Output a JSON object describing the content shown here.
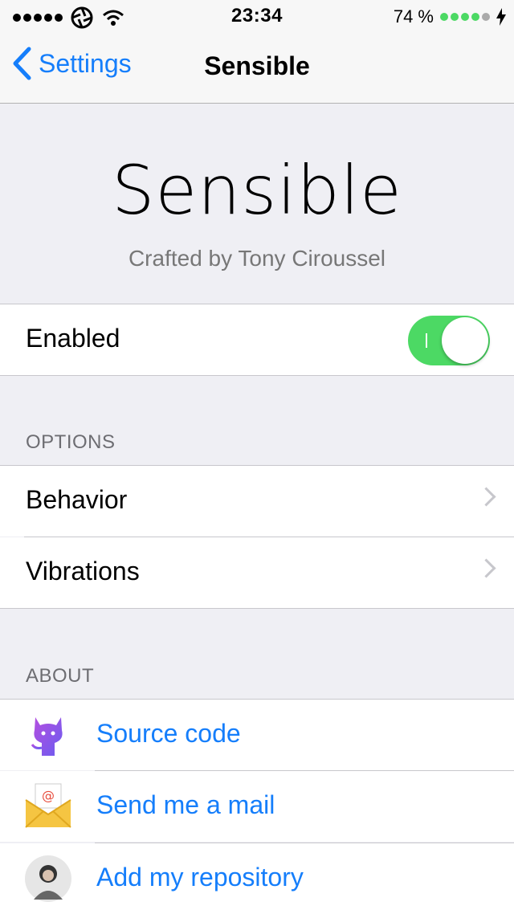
{
  "status_bar": {
    "time": "23:34",
    "battery_percent": "74 %",
    "signal_bars": 5,
    "battery_level": 0.74,
    "icons": [
      "signal-dots-icon",
      "aperture-icon",
      "wifi-icon",
      "battery-dots-icon",
      "charging-bolt-icon"
    ]
  },
  "nav": {
    "back_label": "Settings",
    "title": "Sensible"
  },
  "hero": {
    "title": "Sensible",
    "subtitle": "Crafted by Tony Ciroussel"
  },
  "enabled": {
    "label": "Enabled",
    "on": true
  },
  "options": {
    "header": "OPTIONS",
    "items": [
      {
        "label": "Behavior"
      },
      {
        "label": "Vibrations"
      }
    ]
  },
  "about": {
    "header": "ABOUT",
    "items": [
      {
        "label": "Source code",
        "icon": "octocat-icon"
      },
      {
        "label": "Send me a mail",
        "icon": "mail-envelope-icon"
      },
      {
        "label": "Add my repository",
        "icon": "avatar-photo-icon"
      }
    ]
  },
  "colors": {
    "accent": "#157efb",
    "toggle_on": "#4cd964",
    "battery_green": "#4cd964",
    "background": "#efeff4"
  }
}
